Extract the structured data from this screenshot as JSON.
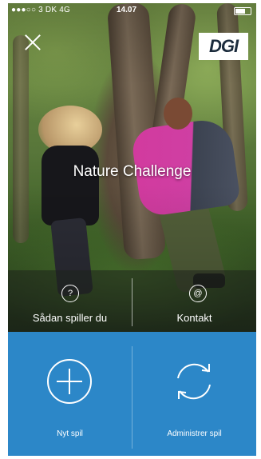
{
  "status_bar": {
    "carrier": "●●●○○ 3 DK  4G",
    "time": "14.07"
  },
  "header": {
    "logo_text": "DGI"
  },
  "title": "Nature Challenge",
  "info_bar": {
    "how_to_play": "Sådan spiller du",
    "how_to_play_icon": "?",
    "contact": "Kontakt",
    "contact_icon": "@"
  },
  "actions": {
    "new_game": "Nyt spil",
    "manage_game": "Administrer spil"
  },
  "colors": {
    "panel_blue": "#2c87c8"
  }
}
